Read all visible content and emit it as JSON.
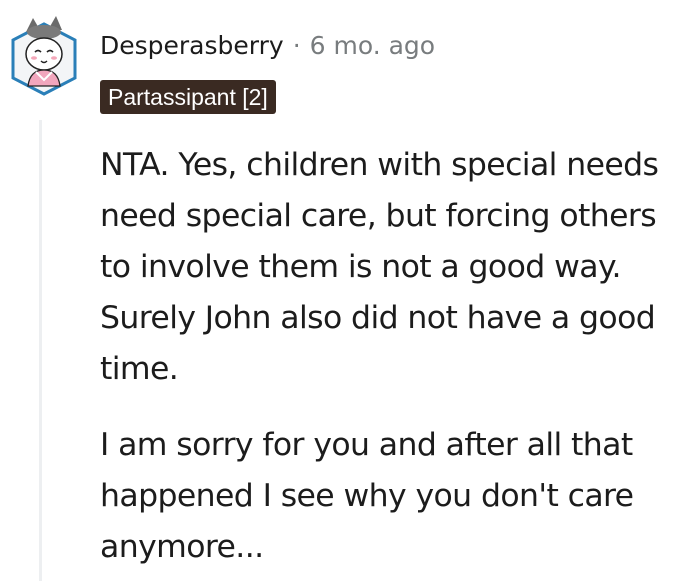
{
  "comment": {
    "author": "Desperasberry",
    "separator": "·",
    "timestamp": "6 mo. ago",
    "flair": "Partassipant [2]",
    "paragraphs": [
      "NTA. Yes, children with special needs need special care, but forcing others to involve them is not a good way. Surely John also did not have a good time.",
      "I am sorry for you and after all that happened I see why you don't care anymore..."
    ]
  },
  "colors": {
    "flair_bg": "#3a2a22",
    "meta_gray": "#787c7e",
    "thread_line": "#edeff1",
    "avatar_border": "#2a7fb8"
  },
  "icons": {
    "avatar": "snoo-avatar-icon"
  }
}
